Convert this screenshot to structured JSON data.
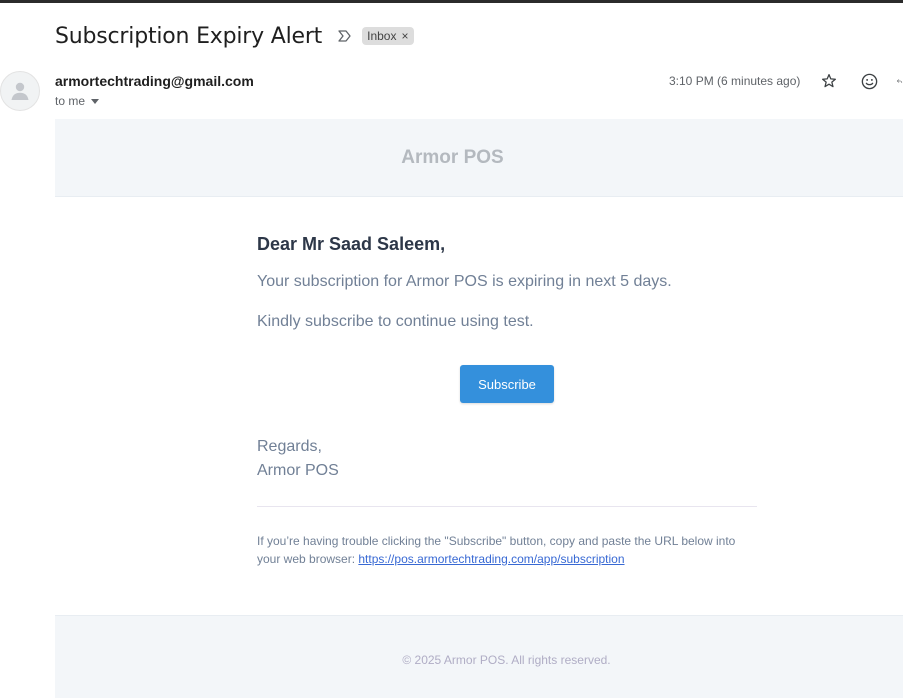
{
  "message": {
    "subject": "Subscription Expiry Alert",
    "label": "Inbox",
    "label_close": "×",
    "sender": "armortechtrading@gmail.com",
    "recipient": "to me",
    "timestamp": "3:10 PM (6 minutes ago)"
  },
  "icons": {
    "importance": "importance-marker-icon",
    "avatar": "person-icon",
    "star": "star-icon",
    "emoji": "emoji-react-icon",
    "reply": "reply-icon"
  },
  "email": {
    "brand": "Armor POS",
    "greeting": "Dear Mr Saad Saleem,",
    "line1": "Your subscription for Armor POS is expiring in next 5 days.",
    "line2": "Kindly subscribe to continue using test.",
    "button": "Subscribe",
    "regards": "Regards,",
    "signature": "Armor POS",
    "subcopy_text": "If you’re having trouble clicking the \"Subscribe\" button, copy and paste the URL below into your web browser: ",
    "subcopy_link": "https://pos.armortechtrading.com/app/subscription",
    "footer": "© 2025 Armor POS. All rights reserved."
  },
  "colors": {
    "button": "#3490dc",
    "header_bg": "#f3f6f9",
    "body_text": "#718096",
    "heading_text": "#2d3748",
    "link": "#3869d4"
  }
}
